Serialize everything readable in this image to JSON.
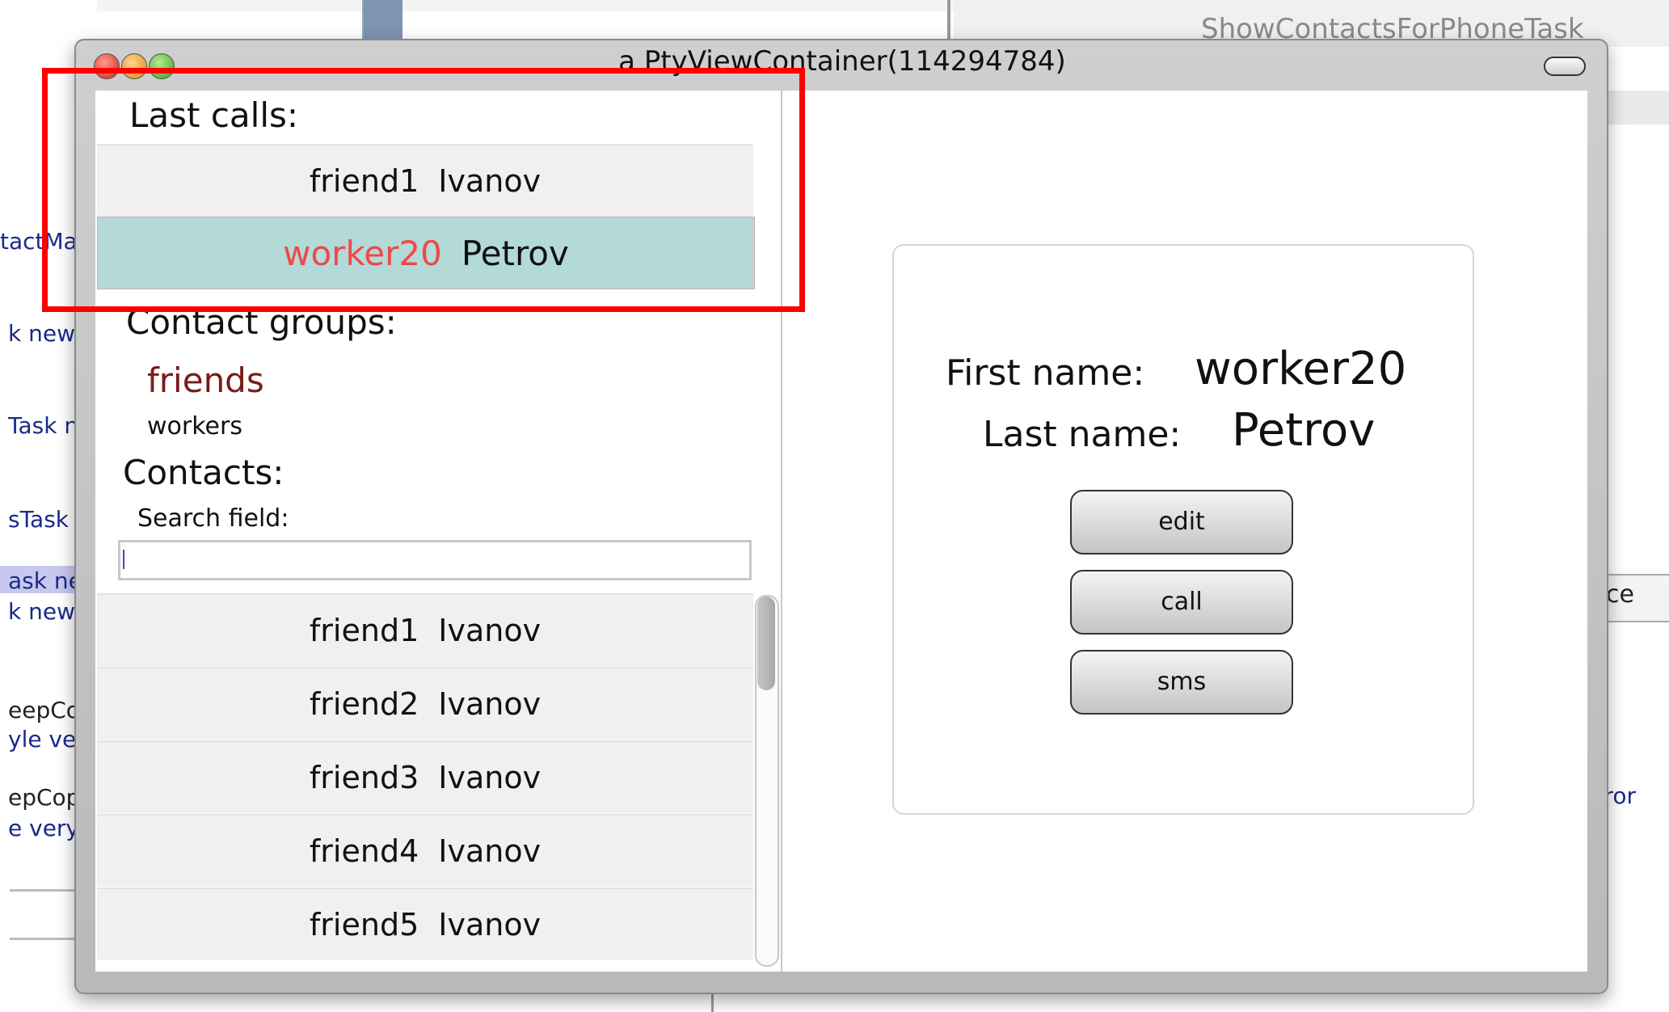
{
  "background": {
    "right_title": "ShowContactsForPhoneTask",
    "right_button": "nce",
    "right_code": "ctFror",
    "left_fragments": [
      {
        "text": "tactMa",
        "black": false
      },
      {
        "text": "k new",
        "black": false
      },
      {
        "text": "Task n",
        "black": false
      },
      {
        "text": "sTask",
        "black": false
      },
      {
        "text": "ask ne",
        "black": false
      },
      {
        "text": "k new",
        "black": false
      },
      {
        "text": "eepCo",
        "black": true
      },
      {
        "text": "yle ve",
        "black": false
      },
      {
        "text": "epCop",
        "black": true
      },
      {
        "text": "e very",
        "black": false
      }
    ]
  },
  "window": {
    "title": "a PtyViewContainer(114294784)"
  },
  "last_calls": {
    "label": "Last calls:",
    "items": [
      {
        "first": "friend1",
        "last": "Ivanov",
        "selected": false
      },
      {
        "first": "worker20",
        "last": "Petrov",
        "selected": true
      }
    ]
  },
  "contact_groups": {
    "label": "Contact groups:",
    "groups": [
      "friends",
      "workers"
    ]
  },
  "contacts": {
    "label": "Contacts:",
    "search_label": "Search field:",
    "search_value": "",
    "items": [
      {
        "first": "friend1",
        "last": "Ivanov"
      },
      {
        "first": "friend2",
        "last": "Ivanov"
      },
      {
        "first": "friend3",
        "last": "Ivanov"
      },
      {
        "first": "friend4",
        "last": "Ivanov"
      },
      {
        "first": "friend5",
        "last": "Ivanov"
      }
    ]
  },
  "detail": {
    "first_name_label": "First name:",
    "first_name_value": "worker20",
    "last_name_label": "Last name:",
    "last_name_value": "Petrov",
    "buttons": [
      "edit",
      "call",
      "sms"
    ]
  },
  "colors": {
    "selected_row": "#b3d9d9",
    "selected_first_name": "#f04848",
    "group_friends": "#7a1a1a",
    "highlight_box": "#ff0000"
  }
}
